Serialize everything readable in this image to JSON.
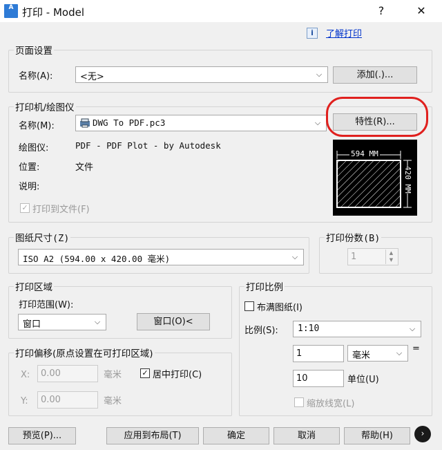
{
  "window": {
    "title": "打印 - Model",
    "help_btn": "?",
    "close_btn": "✕",
    "icon_text": "A"
  },
  "help_link": "了解打印",
  "page_setup": {
    "legend": "页面设置",
    "name_label": "名称(A):",
    "name_value": "<无>",
    "add_button": "添加(.)..."
  },
  "printer": {
    "legend": "打印机/绘图仪",
    "name_label": "名称(M):",
    "name_value": "DWG To PDF.pc3",
    "properties_button": "特性(R)...",
    "plotter_label": "绘图仪:",
    "plotter_value": "PDF - PDF Plot - by Autodesk",
    "location_label": "位置:",
    "location_value": "文件",
    "description_label": "说明:",
    "print_to_file": "打印到文件(F)",
    "print_to_file_checked": true,
    "preview_width_text": "594 MM",
    "preview_height_text": "420 MM"
  },
  "paper_size": {
    "legend": "图纸尺寸(Z)",
    "value": "ISO A2 (594.00 x 420.00 毫米)"
  },
  "copies": {
    "legend": "打印份数(B)",
    "value": "1"
  },
  "plot_area": {
    "legend": "打印区域",
    "range_label": "打印范围(W):",
    "range_value": "窗口",
    "window_button": "窗口(O)<"
  },
  "plot_offset": {
    "legend": "打印偏移(原点设置在可打印区域)",
    "x_label": "X:",
    "x_value": "0.00",
    "y_label": "Y:",
    "y_value": "0.00",
    "unit": "毫米",
    "center_label": "居中打印(C)",
    "center_checked": true
  },
  "plot_scale": {
    "legend": "打印比例",
    "fit_label": "布满图纸(I)",
    "fit_checked": false,
    "scale_label": "比例(S):",
    "scale_value": "1:10",
    "value1": "1",
    "unit_value": "毫米",
    "equals": "=",
    "value2": "10",
    "unit2_label": "单位(U)",
    "lineweight_label": "缩放线宽(L)"
  },
  "footer": {
    "preview": "预览(P)...",
    "apply": "应用到布局(T)",
    "ok": "确定",
    "cancel": "取消",
    "help": "帮助(H)",
    "more": "›"
  },
  "colors": {
    "highlight": "#e0201e",
    "link": "#0033cc"
  }
}
